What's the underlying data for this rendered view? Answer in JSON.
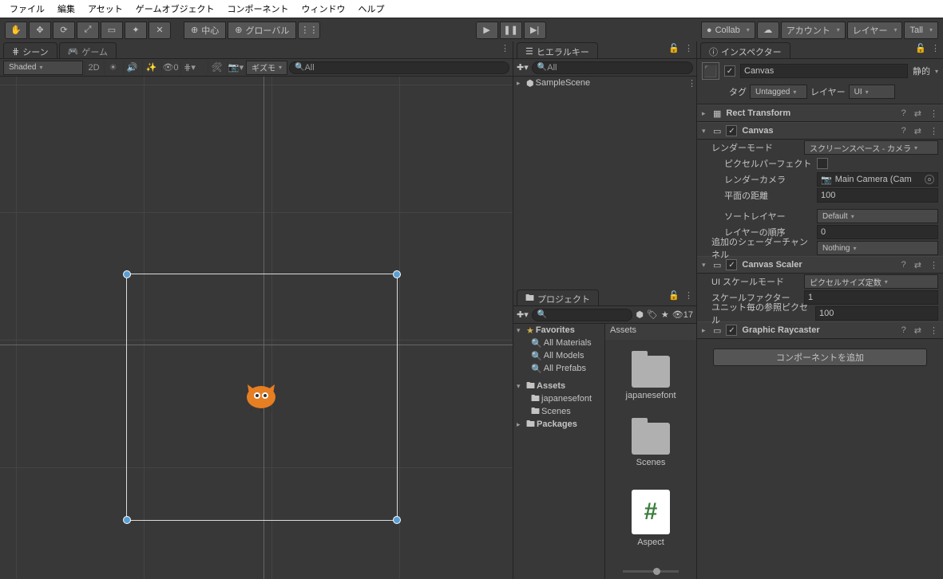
{
  "menu": [
    "ファイル",
    "編集",
    "アセット",
    "ゲームオブジェクト",
    "コンポーネント",
    "ウィンドウ",
    "ヘルプ"
  ],
  "toolbar": {
    "pivot": "中心",
    "space": "グローバル",
    "collab": "Collab",
    "account": "アカウント",
    "layers": "レイヤー",
    "layout": "Tall"
  },
  "sceneTabs": {
    "scene": "シーン",
    "game": "ゲーム"
  },
  "sceneBar": {
    "shading": "Shaded",
    "twoD": "2D",
    "hiddenCount": "0",
    "gizmos": "ギズモ",
    "searchPrefix": "All"
  },
  "hierarchy": {
    "title": "ヒエラルキー",
    "searchPrefix": "All",
    "root": "SampleScene"
  },
  "project": {
    "title": "プロジェクト",
    "hiddenCount": "17",
    "favorites": {
      "label": "Favorites",
      "items": [
        "All Materials",
        "All Models",
        "All Prefabs"
      ]
    },
    "assets": {
      "label": "Assets",
      "children": [
        "japanesefont",
        "Scenes"
      ]
    },
    "packages": "Packages",
    "crumb": "Assets",
    "gridItems": [
      {
        "type": "folder",
        "label": "japanesefont"
      },
      {
        "type": "folder",
        "label": "Scenes"
      },
      {
        "type": "cs",
        "label": "Aspect"
      }
    ]
  },
  "inspector": {
    "title": "インスペクター",
    "name": "Canvas",
    "static": "静的",
    "tagLabel": "タグ",
    "tagValue": "Untagged",
    "layerLabel": "レイヤー",
    "layerValue": "UI",
    "rectTransform": "Rect Transform",
    "canvas": {
      "title": "Canvas",
      "renderMode": {
        "label": "レンダーモード",
        "value": "スクリーンスペース - カメラ"
      },
      "pixelPerfect": "ピクセルパーフェクト",
      "renderCamera": {
        "label": "レンダーカメラ",
        "value": "Main Camera (Cam"
      },
      "planeDistance": {
        "label": "平面の距離",
        "value": "100"
      },
      "sortLayer": {
        "label": "ソートレイヤー",
        "value": "Default"
      },
      "orderInLayer": {
        "label": "レイヤーの順序",
        "value": "0"
      },
      "shaderChannels": {
        "label": "追加のシェーダーチャンネル",
        "value": "Nothing"
      }
    },
    "scaler": {
      "title": "Canvas Scaler",
      "scaleMode": {
        "label": "UI スケールモード",
        "value": "ピクセルサイズ定数"
      },
      "scaleFactor": {
        "label": "スケールファクター",
        "value": "1"
      },
      "refPixels": {
        "label": "ユニット毎の参照ピクセル",
        "value": "100"
      }
    },
    "raycaster": "Graphic Raycaster",
    "addComponent": "コンポーネントを追加"
  }
}
